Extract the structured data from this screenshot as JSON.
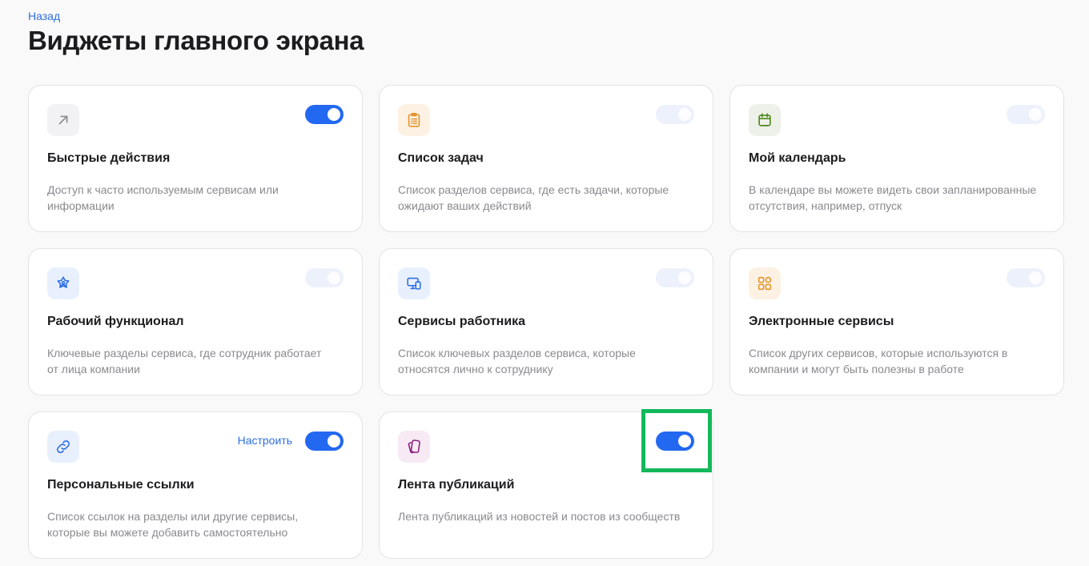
{
  "back_label": "Назад",
  "title": "Виджеты главного экрана",
  "configure_label": "Настроить",
  "colors": {
    "accent": "#2368f0",
    "highlight": "#13b85a"
  },
  "widgets": [
    {
      "icon": "arrow-up-right-icon",
      "title": "Быстрые действия",
      "description": "Доступ к часто используемым сервисам или информации",
      "enabled": true
    },
    {
      "icon": "clipboard-list-icon",
      "title": "Список задач",
      "description": "Список разделов сервиса, где есть задачи, которые ожидают ваших действий",
      "enabled": "disabled"
    },
    {
      "icon": "calendar-icon",
      "title": "Мой календарь",
      "description": "В календаре вы можете видеть свои запланированные отсутствия, например, отпуск",
      "enabled": "disabled"
    },
    {
      "icon": "user-star-icon",
      "title": "Рабочий функционал",
      "description": "Ключевые разделы сервиса, где сотрудник работает от лица компании",
      "enabled": "disabled"
    },
    {
      "icon": "devices-icon",
      "title": "Сервисы работника",
      "description": "Список ключевых разделов сервиса, которые относятся лично к сотруднику",
      "enabled": "disabled"
    },
    {
      "icon": "apps-grid-icon",
      "title": "Электронные сервисы",
      "description": "Список других сервисов, которые используются в компании и могут быть полезны в работе",
      "enabled": "disabled"
    },
    {
      "icon": "link-icon",
      "title": "Персональные ссылки",
      "description": "Список ссылок на разделы или другие сервисы, которые вы можете добавить самостоятельно",
      "enabled": true
    },
    {
      "icon": "publications-icon",
      "title": "Лента публикаций",
      "description": "Лента публикаций из новостей и постов из сообществ",
      "enabled": true
    }
  ]
}
